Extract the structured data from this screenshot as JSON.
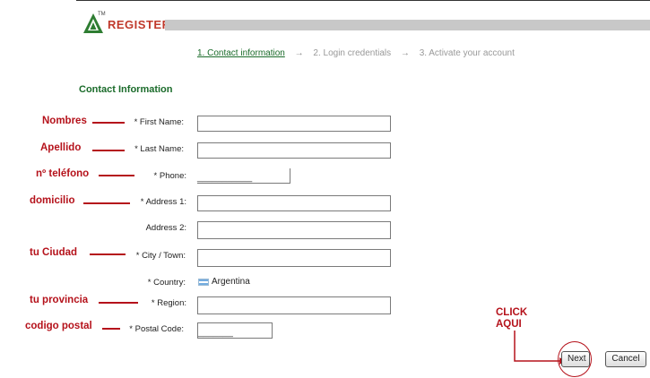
{
  "header": {
    "tm": "TM",
    "title": "REGISTER"
  },
  "steps": {
    "step1": "1. Contact information",
    "step2": "2. Login credentials",
    "step3": "3. Activate your account",
    "arrow": "→"
  },
  "section_title": "Contact Information",
  "fields": {
    "first_name": {
      "label": "* First Name:",
      "value": ""
    },
    "last_name": {
      "label": "* Last Name:",
      "value": ""
    },
    "phone": {
      "label": "* Phone:",
      "value": "",
      "mask": "___________"
    },
    "address1": {
      "label": "* Address 1:",
      "value": ""
    },
    "address2": {
      "label": "Address 2:",
      "value": ""
    },
    "city": {
      "label": "* City / Town:",
      "value": ""
    },
    "country": {
      "label": "* Country:",
      "value": "Argentina"
    },
    "region": {
      "label": "* Region:",
      "value": ""
    },
    "postal": {
      "label": "* Postal Code:",
      "value": "",
      "mask": "_______"
    }
  },
  "annotations": {
    "nombres": "Nombres",
    "apellido": "Apellido",
    "telefono": "nº teléfono",
    "domicilio": "domicilio",
    "ciudad": "tu Ciudad",
    "provincia": "tu provincia",
    "postal": "codigo postal",
    "click_line1": "CLICK",
    "click_line2": "AQUI"
  },
  "buttons": {
    "next": "Next",
    "cancel": "Cancel"
  },
  "colors": {
    "annotation": "#b5121b",
    "accent_green": "#1a6b2a",
    "header_red": "#c0392b"
  }
}
